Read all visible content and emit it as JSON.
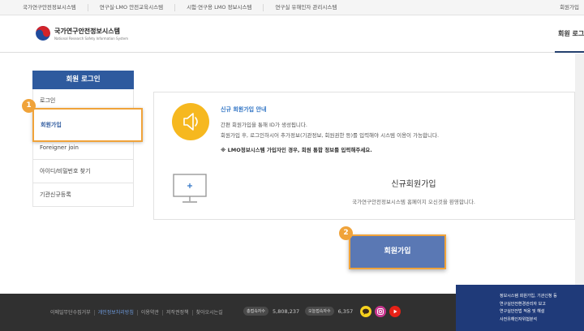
{
  "topbar": {
    "links": [
      "국가연구안전정보시스템",
      "연구실·LMO 안전교육시스템",
      "시험·연구용 LMO 정보시스템",
      "연구실 유해인자 관리시스템"
    ],
    "right_label": "회원가입"
  },
  "header": {
    "logo_ko": "국가연구안전정보시스템",
    "logo_en": "National Research Safety Information System",
    "menu_label": "회원 로그"
  },
  "sidebar": {
    "title": "회원 로그인",
    "items": [
      "로그인",
      "회원가입",
      "Foreigner join",
      "아이디/비밀번호 찾기",
      "기관신규등록"
    ]
  },
  "steps": [
    "1",
    "2"
  ],
  "notice": {
    "title": "신규 회원가입 안내",
    "desc1": "간편 회원가입을 통해 ID가 생성됩니다.",
    "desc2": "회원가입 후, 로그인하시어 추가정보(기관정보, 회원권한 등)를 입력해야 시스템 이용이 가능합니다.",
    "note": "※ LMO정보시스템 가입자인 경우, 회원 통합 정보를 입력해주세요."
  },
  "signup": {
    "title": "신규회원가입",
    "desc": "국가연구안전정보시스템 홈페이지 오신것을 환영합니다.",
    "button_label": "회원가입"
  },
  "footer": {
    "links": [
      "이메일무단수집거부",
      "개인정보처리방침",
      "이용약관",
      "저작권정책",
      "찾아오시는길"
    ],
    "total_label": "총접속자수",
    "total_value": "5,808,237",
    "today_label": "오늘접속자수",
    "today_value": "6,357",
    "social": [
      "kakao-icon",
      "instagram-icon",
      "youtube-icon"
    ],
    "sitemap": [
      "정보시스템 회원가입, 기관신청 등",
      "연구실안전환경관리자 보고",
      "연구실안전법 적용 및 해설",
      "사전유해인자위험분석"
    ]
  },
  "colors": {
    "primary": "#2e5a9e",
    "highlight": "#f0a33a",
    "notice_circle": "#f6b81f",
    "footer_bg": "#303030"
  }
}
